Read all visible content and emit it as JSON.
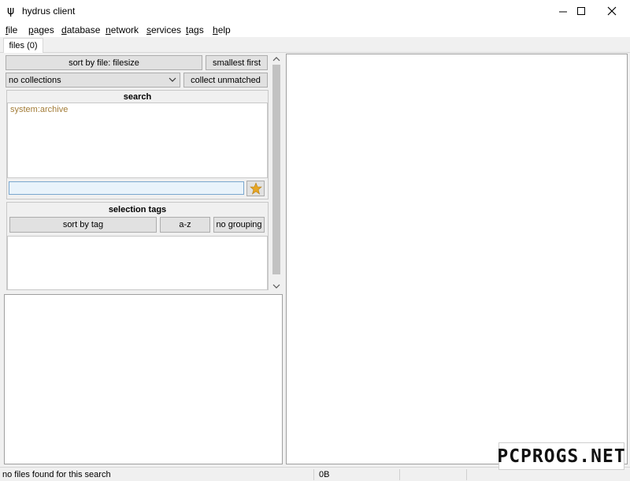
{
  "window": {
    "title": "hydrus client"
  },
  "menu": [
    "file",
    "pages",
    "database",
    "network",
    "services",
    "tags",
    "help"
  ],
  "tabs": [
    {
      "label": "files (0)"
    }
  ],
  "sort": {
    "sort_by_label": "sort by file: filesize",
    "order_label": "smallest first"
  },
  "collections": {
    "selected": "no collections",
    "collect_label": "collect unmatched"
  },
  "search": {
    "title": "search",
    "predicates": [
      "system:archive"
    ],
    "input_value": "",
    "input_placeholder": ""
  },
  "selection_tags": {
    "title": "selection tags",
    "sort_by": "sort by tag",
    "order": "a-z",
    "grouping": "no grouping"
  },
  "status": {
    "message": "no files found for this search",
    "size": "0B"
  },
  "watermark": {
    "text": "PCPROGS.NET"
  },
  "colors": {
    "predicate": "#a37c37",
    "star": "#e7a624"
  }
}
